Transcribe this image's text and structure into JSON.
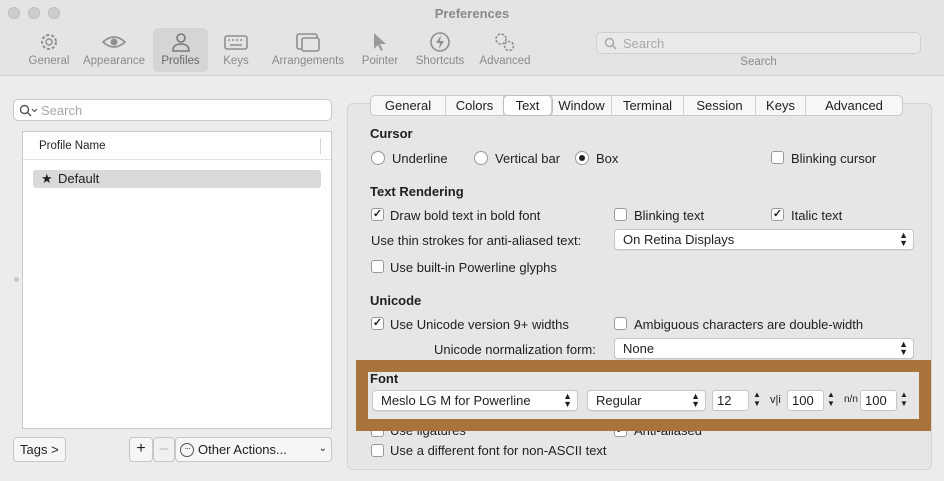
{
  "window": {
    "title": "Preferences"
  },
  "toolbar": {
    "items": [
      {
        "label": "General",
        "icon": "gear-icon"
      },
      {
        "label": "Appearance",
        "icon": "eye-icon"
      },
      {
        "label": "Profiles",
        "icon": "person-icon",
        "active": true
      },
      {
        "label": "Keys",
        "icon": "keyboard-icon"
      },
      {
        "label": "Arrangements",
        "icon": "windows-icon"
      },
      {
        "label": "Pointer",
        "icon": "pointer-icon"
      },
      {
        "label": "Shortcuts",
        "icon": "lightning-icon"
      },
      {
        "label": "Advanced",
        "icon": "gears-icon"
      }
    ],
    "search_placeholder": "Search",
    "search_label": "Search"
  },
  "left": {
    "search_placeholder": "Search",
    "column_header": "Profile Name",
    "profiles": [
      {
        "name": "Default",
        "icon": "star-icon"
      }
    ],
    "tags_button": "Tags >",
    "add_button": "+",
    "remove_button": "–",
    "other_actions": "Other Actions..."
  },
  "tabs": [
    "General",
    "Colors",
    "Text",
    "Window",
    "Terminal",
    "Session",
    "Keys",
    "Advanced"
  ],
  "active_tab": "Text",
  "cursor": {
    "title": "Cursor",
    "underline": "Underline",
    "vertical_bar": "Vertical bar",
    "box": "Box",
    "selected": "Box",
    "blinking": "Blinking cursor",
    "blinking_checked": false
  },
  "text_rendering": {
    "title": "Text Rendering",
    "bold": "Draw bold text in bold font",
    "bold_checked": true,
    "blinking_text": "Blinking text",
    "blinking_text_checked": false,
    "italic": "Italic text",
    "italic_checked": true,
    "thin_strokes_label": "Use thin strokes for anti-aliased text:",
    "thin_strokes_value": "On Retina Displays",
    "powerline": "Use built-in Powerline glyphs",
    "powerline_checked": false
  },
  "unicode": {
    "title": "Unicode",
    "version9": "Use Unicode version 9+ widths",
    "version9_checked": true,
    "ambiguous": "Ambiguous characters are double-width",
    "ambiguous_checked": false,
    "normalization_label": "Unicode normalization form:",
    "normalization_value": "None"
  },
  "font": {
    "title": "Font",
    "family": "Meslo LG M for Powerline",
    "weight": "Regular",
    "size": "12",
    "vertical_label": "v|i",
    "vertical_spacing": "100",
    "horizontal_label": "n/n",
    "horizontal_spacing": "100",
    "ligatures": "Use ligatures",
    "ligatures_checked": false,
    "anti_aliased": "Anti-aliased",
    "anti_aliased_checked": true,
    "non_ascii": "Use a different font for non-ASCII text",
    "non_ascii_checked": false
  },
  "colors": {
    "highlight": "#a8743b",
    "active_toolbar": "#d5d5d5"
  }
}
